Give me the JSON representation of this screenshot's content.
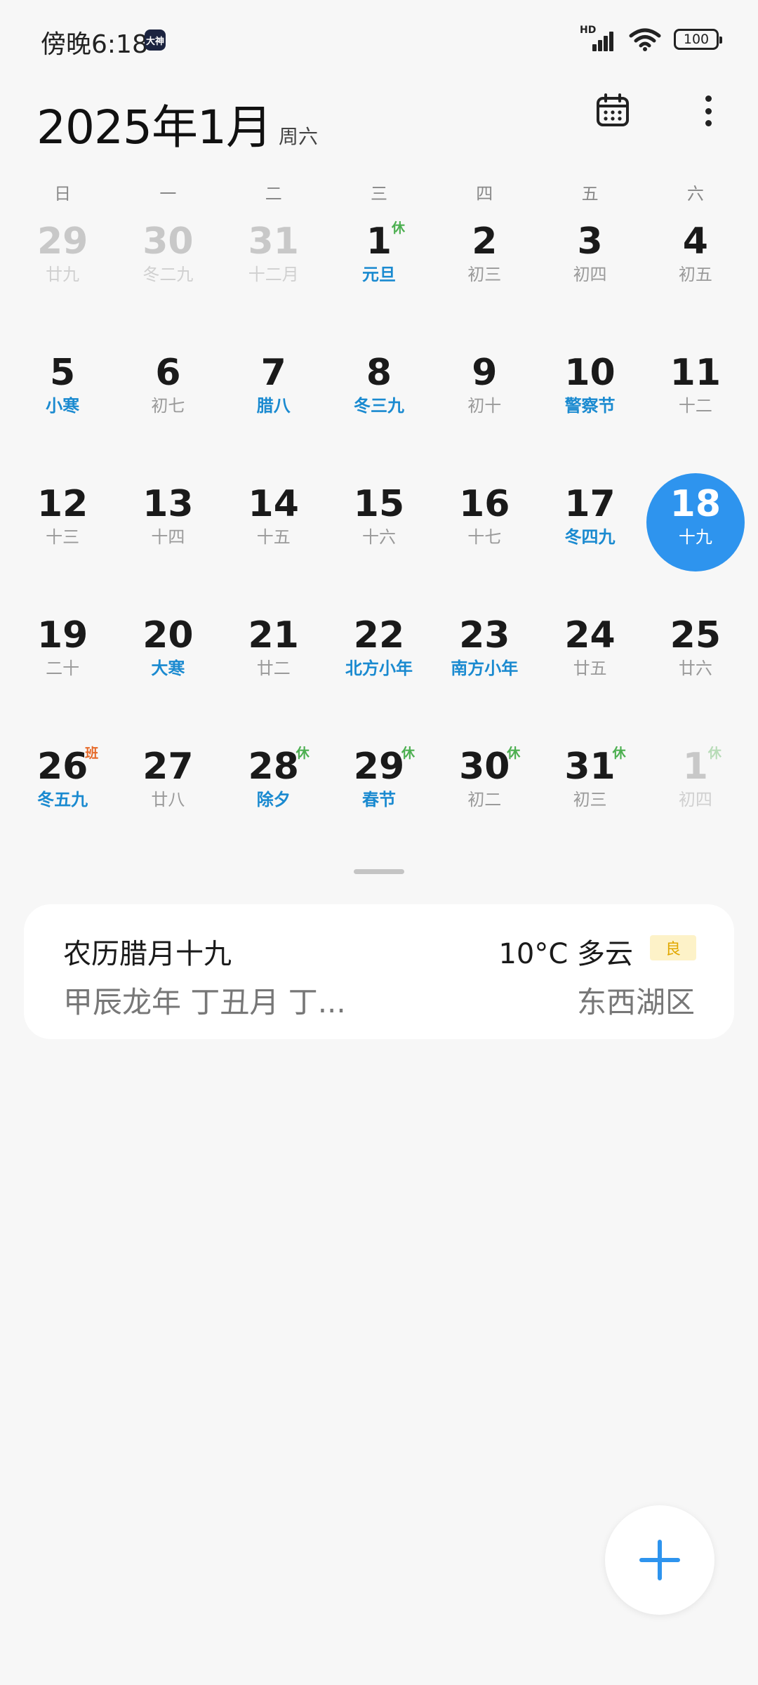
{
  "status_bar": {
    "time": "傍晚6:18",
    "app_badge": "大神",
    "signal_label": "HD",
    "battery": "100"
  },
  "header": {
    "month_title": "2025年1月",
    "weekday": "周六"
  },
  "weekdays": [
    "日",
    "一",
    "二",
    "三",
    "四",
    "五",
    "六"
  ],
  "days": [
    {
      "num": "29",
      "sub": "廿九",
      "other": true
    },
    {
      "num": "30",
      "sub": "冬二九",
      "other": true
    },
    {
      "num": "31",
      "sub": "十二月",
      "other": true
    },
    {
      "num": "1",
      "sub": "元旦",
      "festival": true,
      "badge": "休",
      "badge_type": "rest"
    },
    {
      "num": "2",
      "sub": "初三"
    },
    {
      "num": "3",
      "sub": "初四"
    },
    {
      "num": "4",
      "sub": "初五"
    },
    {
      "num": "5",
      "sub": "小寒",
      "festival": true
    },
    {
      "num": "6",
      "sub": "初七"
    },
    {
      "num": "7",
      "sub": "腊八",
      "festival": true
    },
    {
      "num": "8",
      "sub": "冬三九",
      "festival": true
    },
    {
      "num": "9",
      "sub": "初十"
    },
    {
      "num": "10",
      "sub": "警察节",
      "festival": true
    },
    {
      "num": "11",
      "sub": "十二"
    },
    {
      "num": "12",
      "sub": "十三"
    },
    {
      "num": "13",
      "sub": "十四"
    },
    {
      "num": "14",
      "sub": "十五"
    },
    {
      "num": "15",
      "sub": "十六"
    },
    {
      "num": "16",
      "sub": "十七"
    },
    {
      "num": "17",
      "sub": "冬四九",
      "festival": true
    },
    {
      "num": "18",
      "sub": "十九",
      "selected": true
    },
    {
      "num": "19",
      "sub": "二十"
    },
    {
      "num": "20",
      "sub": "大寒",
      "festival": true
    },
    {
      "num": "21",
      "sub": "廿二"
    },
    {
      "num": "22",
      "sub": "北方小年",
      "festival": true
    },
    {
      "num": "23",
      "sub": "南方小年",
      "festival": true
    },
    {
      "num": "24",
      "sub": "廿五"
    },
    {
      "num": "25",
      "sub": "廿六"
    },
    {
      "num": "26",
      "sub": "冬五九",
      "festival": true,
      "badge": "班",
      "badge_type": "work"
    },
    {
      "num": "27",
      "sub": "廿八"
    },
    {
      "num": "28",
      "sub": "除夕",
      "festival": true,
      "badge": "休",
      "badge_type": "rest"
    },
    {
      "num": "29",
      "sub": "春节",
      "festival": true,
      "badge": "休",
      "badge_type": "rest"
    },
    {
      "num": "30",
      "sub": "初二",
      "badge": "休",
      "badge_type": "rest"
    },
    {
      "num": "31",
      "sub": "初三",
      "badge": "休",
      "badge_type": "rest"
    },
    {
      "num": "1",
      "sub": "初四",
      "other": true,
      "badge": "休",
      "badge_type": "rest"
    }
  ],
  "info_card": {
    "lunar_date": "农历腊月十九",
    "ganzhi": "甲辰龙年 丁丑月 丁...",
    "weather": "10°C 多云",
    "aqi": "良",
    "location": "东西湖区"
  },
  "colors": {
    "accent": "#2e94ee",
    "festival": "#1a8ad0",
    "rest_badge": "#4caf50",
    "work_badge": "#e66a2a"
  }
}
